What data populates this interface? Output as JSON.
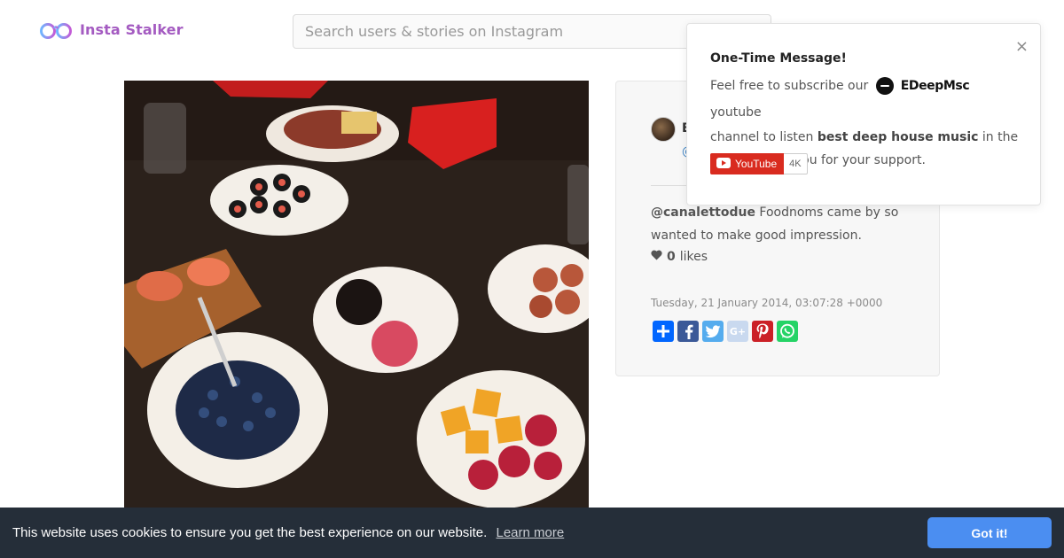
{
  "header": {
    "logo_text": "Insta Stalker",
    "logo_icon": "binoculars-icon",
    "search_placeholder": "Search users & stories on Instagram"
  },
  "post": {
    "image_alt": "",
    "user_initial": "E",
    "user_at": "@",
    "caption_mention": "@canalettodue",
    "caption_text": "Foodnoms came by so wanted to make good impression.",
    "likes_count": "0",
    "likes_label": "likes",
    "timestamp": "Tuesday, 21 January 2014, 03:07:28 +0000",
    "share_icons": [
      "share-plus-icon",
      "facebook-icon",
      "twitter-icon",
      "google-plus-icon",
      "pinterest-icon",
      "whatsapp-icon"
    ]
  },
  "popup": {
    "close_label": "×",
    "title": "One-Time Message!",
    "text_before": "Feel free to subscribe our",
    "channel_name": "EDeepMsc",
    "text_after_channel": "youtube",
    "text_line2_start": "channel to listen",
    "text_bold": "best deep house music",
    "text_line2_end": "in the",
    "text_line3": "world. Thank you for your support.",
    "youtube_label": "YouTube",
    "youtube_count": "4K"
  },
  "cookie": {
    "message": "This website uses cookies to ensure you get the best experience on our website.",
    "learn_more": "Learn more",
    "button_label": "Got it!"
  },
  "colors": {
    "logo_purple": "#a45bc1",
    "cookie_bg": "#252e39",
    "cookie_button": "#4b8ef1",
    "youtube_red": "#d92b1f",
    "facebook": "#3b5998",
    "twitter": "#55acee",
    "google_plus_faded": "#c9d9ef",
    "pinterest": "#cb2027",
    "whatsapp": "#25d366",
    "share_blue": "#0166ff"
  }
}
